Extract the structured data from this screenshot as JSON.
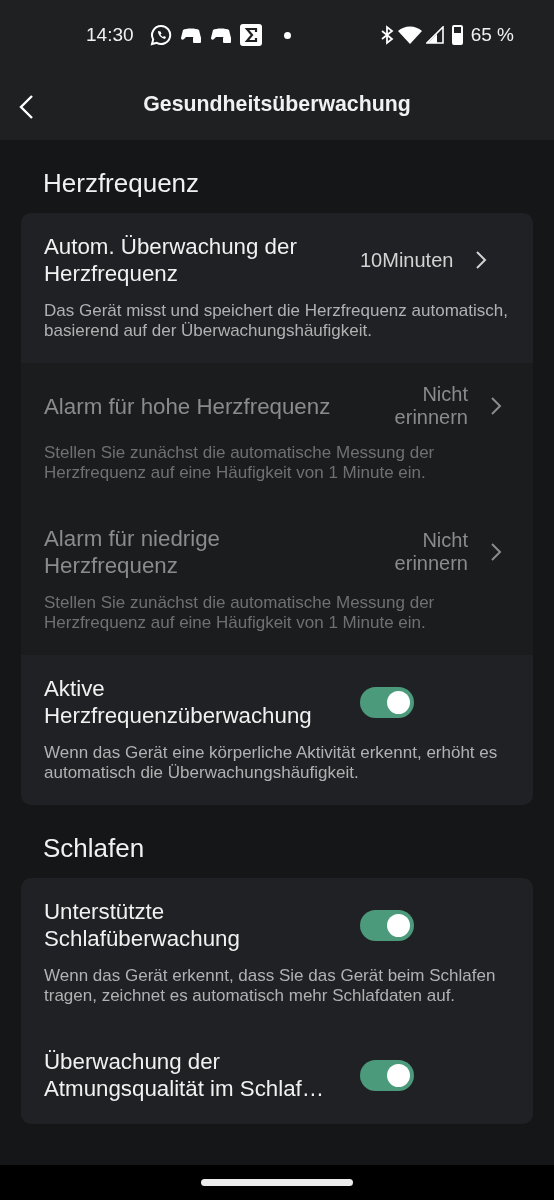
{
  "status_bar": {
    "time": "14:30",
    "notification_dot": true,
    "battery_text": "65 %"
  },
  "header": {
    "title": "Gesundheitsüberwachung"
  },
  "sections": [
    {
      "title": "Herzfrequenz",
      "rows": [
        {
          "kind": "nav",
          "title": "Autom. Überwachung der Herzfrequenz",
          "value": "10Minuten",
          "disabled": false,
          "description": "Das Gerät misst und speichert die Herzfrequenz automatisch, basierend auf der Überwachungshäufigkeit."
        },
        {
          "kind": "nav",
          "title": "Alarm für hohe Herzfrequenz",
          "value": "Nicht erinnern",
          "disabled": true,
          "description": "Stellen Sie zunächst die automatische Messung der Herzfrequenz auf eine Häufigkeit von 1 Minute ein."
        },
        {
          "kind": "nav",
          "title": "Alarm für niedrige Herzfrequenz",
          "value": "Nicht erinnern",
          "disabled": true,
          "description": "Stellen Sie zunächst die automatische Messung der Herzfrequenz auf eine Häufigkeit von 1 Minute ein."
        },
        {
          "kind": "toggle",
          "title": "Aktive Herzfrequenzüberwachung",
          "on": true,
          "description": "Wenn das Gerät eine körperliche Aktivität erkennt, erhöht es automatisch die Überwachungshäufigkeit."
        }
      ]
    },
    {
      "title": "Schlafen",
      "rows": [
        {
          "kind": "toggle",
          "title": "Unterstützte Schlafüberwachung",
          "on": true,
          "description": "Wenn das Gerät erkennt, dass Sie das Gerät beim Schlafen tragen, zeichnet es automatisch mehr Schlafdaten auf."
        },
        {
          "kind": "toggle",
          "title": "Überwachung der Atmungsqualität im Schlaf…",
          "on": true
        }
      ]
    }
  ]
}
